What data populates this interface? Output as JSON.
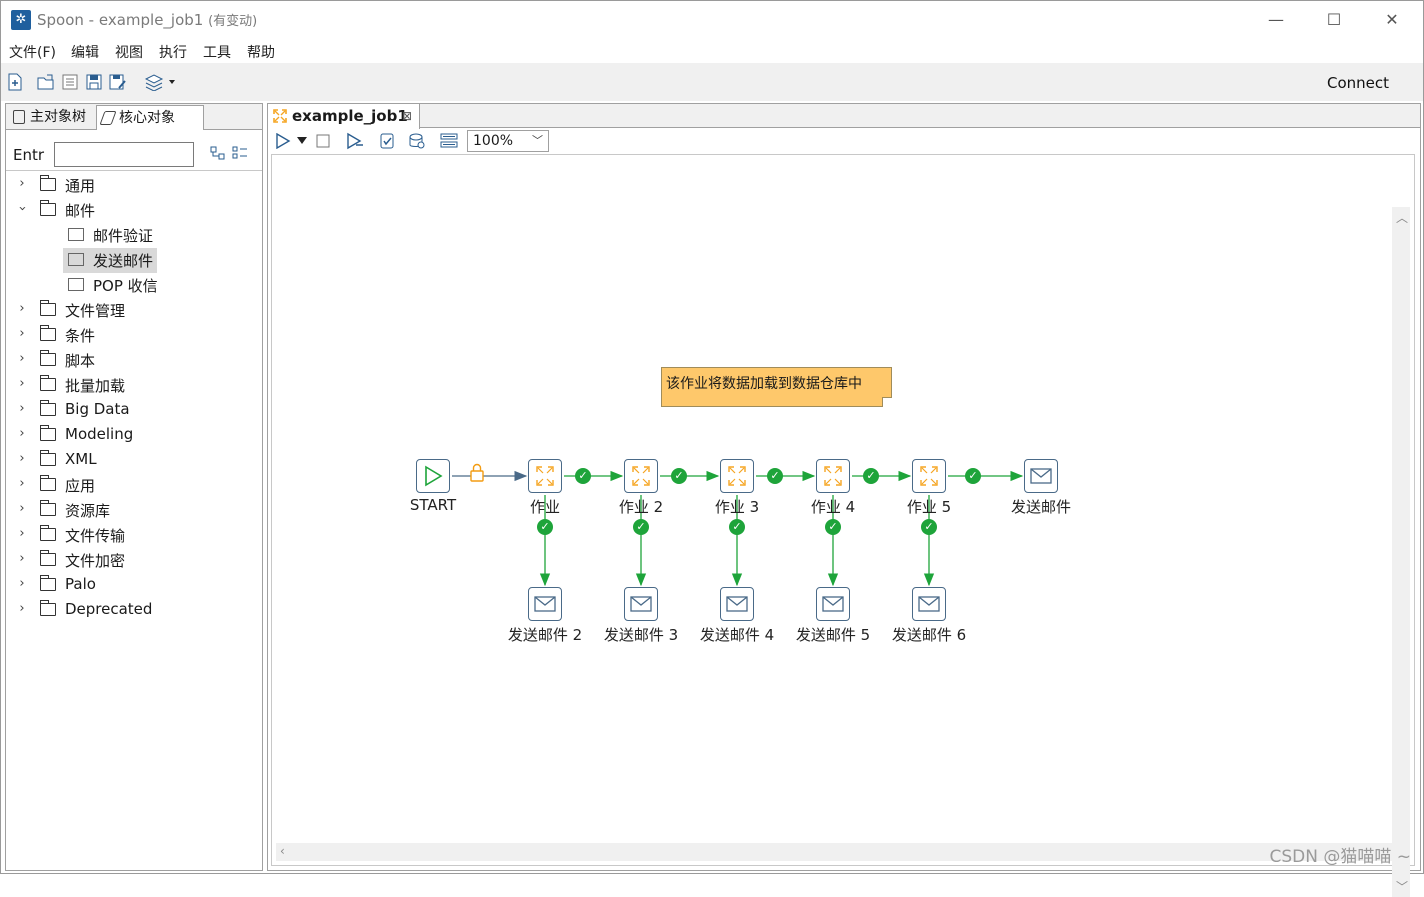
{
  "window": {
    "app_name": "Spoon - example_job1",
    "status": "(有变动)",
    "minimize": "—",
    "maximize": "☐",
    "close": "✕"
  },
  "menu": [
    "文件(F)",
    "编辑",
    "视图",
    "执行",
    "工具",
    "帮助"
  ],
  "toolbar": {
    "icons": [
      "new-file-icon",
      "open-file-icon",
      "explore-repository-icon",
      "save-icon",
      "save-as-icon",
      "perspective-icon"
    ],
    "connect_label": "Connect"
  },
  "left_panel": {
    "tabs": [
      "主对象树",
      "核心对象"
    ],
    "search_label": "Entr",
    "search_value": "",
    "tree": [
      {
        "label": "通用",
        "expanded": false
      },
      {
        "label": "邮件",
        "expanded": true,
        "children": [
          "邮件验证",
          "发送邮件",
          "POP 收信"
        ],
        "selected_child": "发送邮件"
      },
      {
        "label": "文件管理",
        "expanded": false
      },
      {
        "label": "条件",
        "expanded": false
      },
      {
        "label": "脚本",
        "expanded": false
      },
      {
        "label": "批量加载",
        "expanded": false
      },
      {
        "label": "Big Data",
        "expanded": false
      },
      {
        "label": "Modeling",
        "expanded": false
      },
      {
        "label": "XML",
        "expanded": false
      },
      {
        "label": "应用",
        "expanded": false
      },
      {
        "label": "资源库",
        "expanded": false
      },
      {
        "label": "文件传输",
        "expanded": false
      },
      {
        "label": "文件加密",
        "expanded": false
      },
      {
        "label": "Palo",
        "expanded": false
      },
      {
        "label": "Deprecated",
        "expanded": false
      }
    ]
  },
  "editor": {
    "tab_label": "example_job1",
    "zoom": "100%",
    "note": "该作业将数据加载到数据仓库中",
    "nodes": {
      "start": "START",
      "job1": "作业",
      "job2": "作业 2",
      "job3": "作业 3",
      "job4": "作业 4",
      "job5": "作业 5",
      "mail1": "发送邮件",
      "mail2": "发送邮件 2",
      "mail3": "发送邮件 3",
      "mail4": "发送邮件 4",
      "mail5": "发送邮件 5",
      "mail6": "发送邮件 6"
    }
  },
  "watermark": "CSDN @猫喵喵 ~",
  "colors": {
    "hop_success": "#1ea43a",
    "hop_unconditional": "#4a6a88",
    "lock": "#f39c12",
    "note_bg": "#fec86b",
    "job_icon": "#f5a623"
  }
}
